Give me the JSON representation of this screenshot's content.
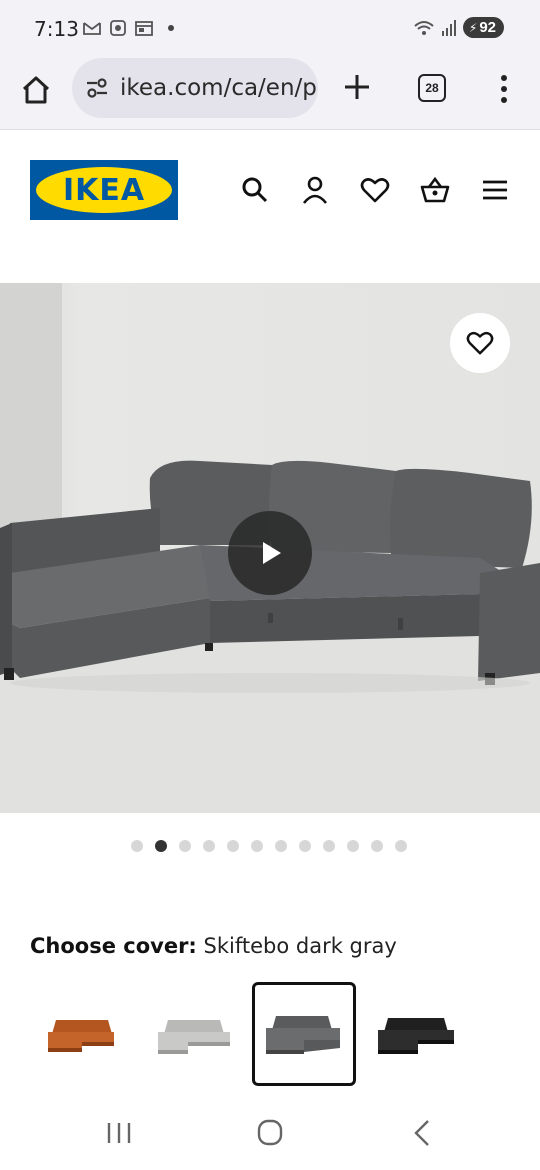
{
  "status_bar": {
    "time": "7:13",
    "battery": "92",
    "icons": [
      "gmail-icon",
      "screenshot-icon",
      "calendar-icon"
    ],
    "right_icons": [
      "wifi-icon",
      "signal-icon",
      "battery-icon"
    ]
  },
  "browser": {
    "url": "ikea.com/ca/en/p/",
    "tab_count": "28",
    "icons": [
      "home-icon",
      "site-info-icon",
      "new-tab-icon",
      "tabs-icon",
      "more-icon"
    ]
  },
  "header": {
    "logo_text": "IKEA",
    "brand_colors": {
      "blue": "#0058a3",
      "yellow": "#ffdb00"
    },
    "icons": [
      "search-icon",
      "account-icon",
      "favorites-icon",
      "cart-icon",
      "hamburger-menu-icon"
    ]
  },
  "gallery": {
    "total_images": 12,
    "active_index": 1,
    "overlay_icons": [
      "heart-icon",
      "play-icon"
    ]
  },
  "cover": {
    "label": "Choose cover:",
    "selected_value": "Skiftebo dark gray",
    "options": [
      {
        "color": "#c4642b",
        "selected": false
      },
      {
        "color": "#c9c9c7",
        "selected": false
      },
      {
        "color": "#6b6c6e",
        "selected": true
      },
      {
        "color": "#2d2d2e",
        "selected": false
      }
    ]
  },
  "nav_bar": {
    "icons": [
      "recent-apps-icon",
      "home-circle-icon",
      "back-icon"
    ]
  }
}
